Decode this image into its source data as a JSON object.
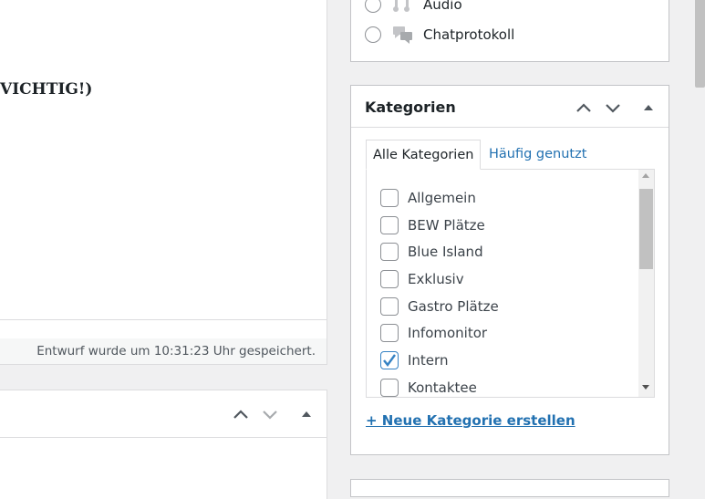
{
  "editor": {
    "heading_fragment": "VICHTIG!)",
    "status": "Entwurf wurde um 10:31:23 Uhr gespeichert."
  },
  "format_box": {
    "options": [
      {
        "label": "Audio",
        "icon": "audio-icon"
      },
      {
        "label": "Chatprotokoll",
        "icon": "chat-icon"
      }
    ]
  },
  "categories": {
    "title": "Kategorien",
    "tabs": {
      "all": "Alle Kategorien",
      "popular": "Häufig genutzt"
    },
    "items": [
      {
        "label": "Allgemein",
        "checked": false
      },
      {
        "label": "BEW Plätze",
        "checked": false
      },
      {
        "label": "Blue Island",
        "checked": false
      },
      {
        "label": "Exklusiv",
        "checked": false
      },
      {
        "label": "Gastro Plätze",
        "checked": false
      },
      {
        "label": "Infomonitor",
        "checked": false
      },
      {
        "label": "Intern",
        "checked": true
      },
      {
        "label": "Kontaktee",
        "checked": false
      }
    ],
    "add_link": "+ Neue Kategorie erstellen"
  },
  "colors": {
    "accent": "#2271b1",
    "checkbox_checked": "#3582c4",
    "border": "#c3c4c7"
  }
}
